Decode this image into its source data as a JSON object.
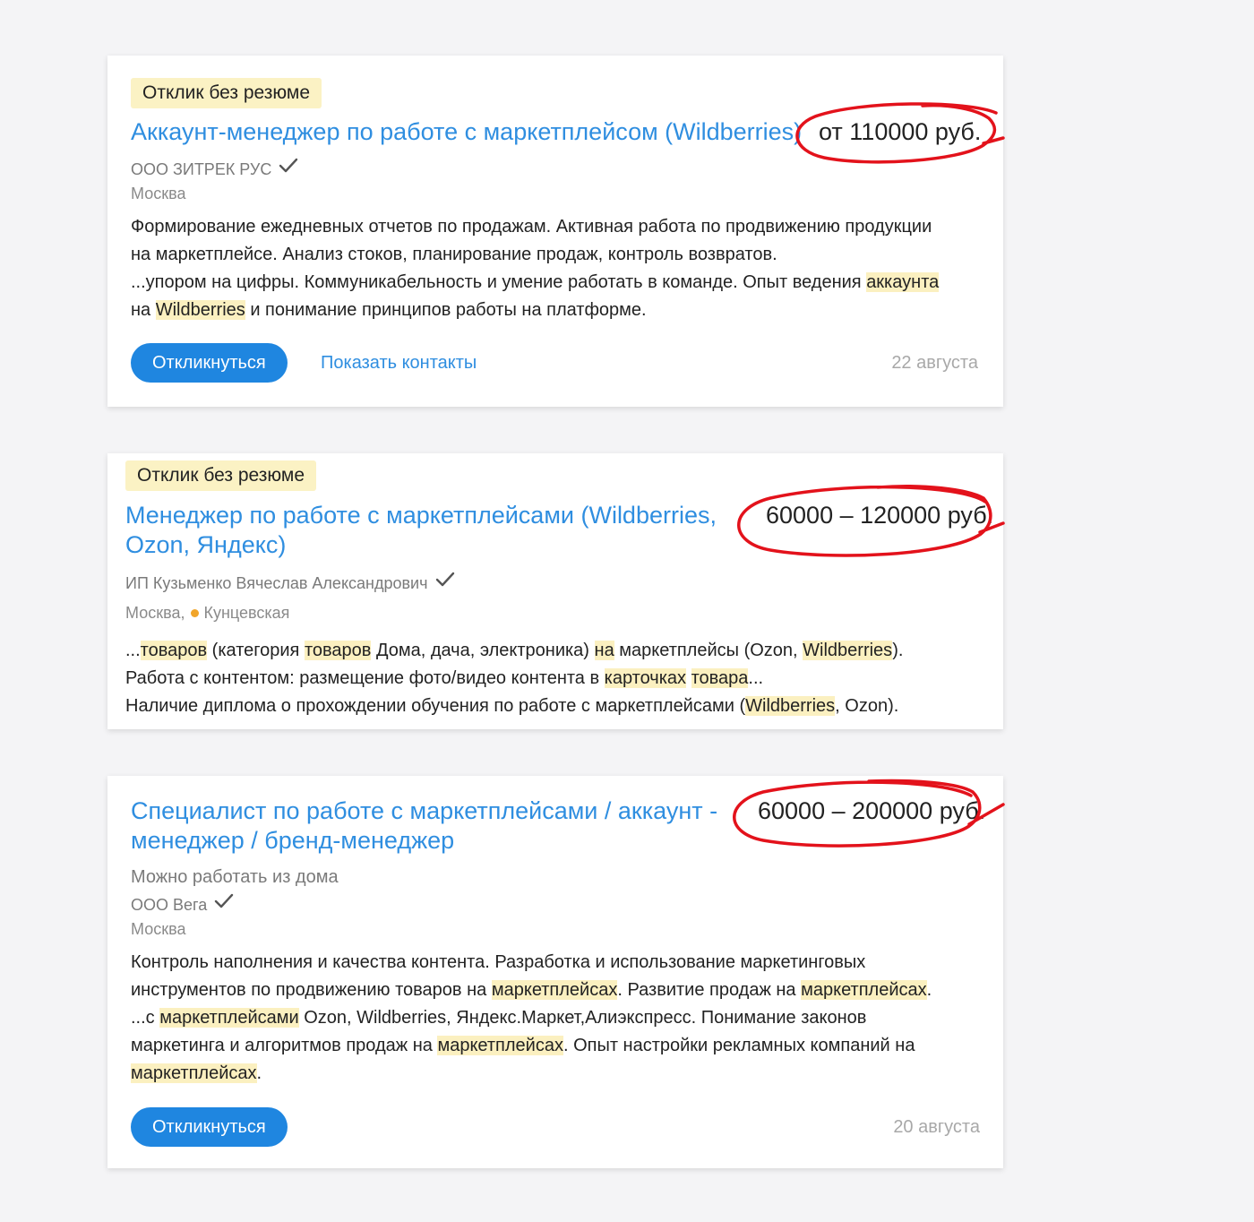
{
  "colors": {
    "title": "#2f8ee0",
    "button": "#1f86e0",
    "highlight": "#fbf0c0",
    "badge": "#fbf2c4",
    "annotation": "#e3121b",
    "metro_dot": "#f1a52a"
  },
  "vacancies": [
    {
      "badge": "Отклик без резюме",
      "title_lines": [
        "Аккаунт-менеджер по работе с маркетплейсом (Wildberries)"
      ],
      "salary": "от 110000 руб.",
      "company": "ООО ЗИТРЕК РУС",
      "city": "Москва",
      "description_lines": [
        [
          {
            "t": "Формирование ежедневных отчетов по продажам. Активная работа по продвижению продукции"
          }
        ],
        [
          {
            "t": "на маркетплейсе. Анализ стоков, планирование продаж, контроль возвратов."
          }
        ],
        [
          {
            "t": "...упором на цифры. Коммуникабельность и умение работать в команде. Опыт ведения "
          },
          {
            "t": "аккаунта",
            "hl": true
          }
        ],
        [
          {
            "t": "на "
          },
          {
            "t": "Wildberries",
            "hl": true
          },
          {
            "t": " и понимание принципов работы на платформе."
          }
        ]
      ],
      "respond_label": "Откликнуться",
      "contacts_label": "Показать контакты",
      "date": "22 августа"
    },
    {
      "badge": "Отклик без резюме",
      "title_lines": [
        "Менеджер по работе с маркетплейсами (Wildberries,",
        "Ozon, Яндекс)"
      ],
      "salary": "60000 – 120000 руб.",
      "company": "ИП Кузьменко Вячеслав Александрович",
      "city": "Москва,",
      "metro": "Кунцевская",
      "description_lines": [
        [
          {
            "t": "..."
          },
          {
            "t": "товаров",
            "hl": true
          },
          {
            "t": " (категория "
          },
          {
            "t": "товаров",
            "hl": true
          },
          {
            "t": " Дома, дача, электроника) "
          },
          {
            "t": "на",
            "hl": true
          },
          {
            "t": " маркетплейсы (Ozon, "
          },
          {
            "t": "Wildberries",
            "hl": true
          },
          {
            "t": ")."
          }
        ],
        [
          {
            "t": "Работа с контентом: размещение фото/видео контента в "
          },
          {
            "t": "карточках",
            "hl": true
          },
          {
            "t": " "
          },
          {
            "t": "товара",
            "hl": true
          },
          {
            "t": "..."
          }
        ],
        [
          {
            "t": "Наличие диплома о прохождении обучения по работе с маркетплейсами ("
          },
          {
            "t": "Wildberries",
            "hl": true
          },
          {
            "t": ", Ozon)."
          }
        ]
      ]
    },
    {
      "title_lines": [
        "Специалист по работе с маркетплейсами / аккаунт -",
        "менеджер / бренд-менеджер"
      ],
      "salary": "60000 – 200000 руб.",
      "remote": "Можно работать из дома",
      "company": "ООО Вега",
      "city": "Москва",
      "description_lines": [
        [
          {
            "t": "Контроль наполнения и качества контента. Разработка и использование маркетинговых"
          }
        ],
        [
          {
            "t": "инструментов по продвижению товаров на "
          },
          {
            "t": "маркетплейсах",
            "hl": true
          },
          {
            "t": ". Развитие продаж на "
          },
          {
            "t": "маркетплейсах",
            "hl": true
          },
          {
            "t": "."
          }
        ],
        [
          {
            "t": "...с "
          },
          {
            "t": "маркетплейсами",
            "hl": true
          },
          {
            "t": " Ozon, Wildberries, Яндекс.Маркет,Алиэкспресс. Понимание законов"
          }
        ],
        [
          {
            "t": "маркетинга и алгоритмов продаж на "
          },
          {
            "t": "маркетплейсах",
            "hl": true
          },
          {
            "t": ". Опыт настройки рекламных компаний на"
          }
        ],
        [
          {
            "t": "маркетплейсах",
            "hl": true
          },
          {
            "t": "."
          }
        ]
      ],
      "respond_label": "Откликнуться",
      "date": "20 августа"
    }
  ]
}
